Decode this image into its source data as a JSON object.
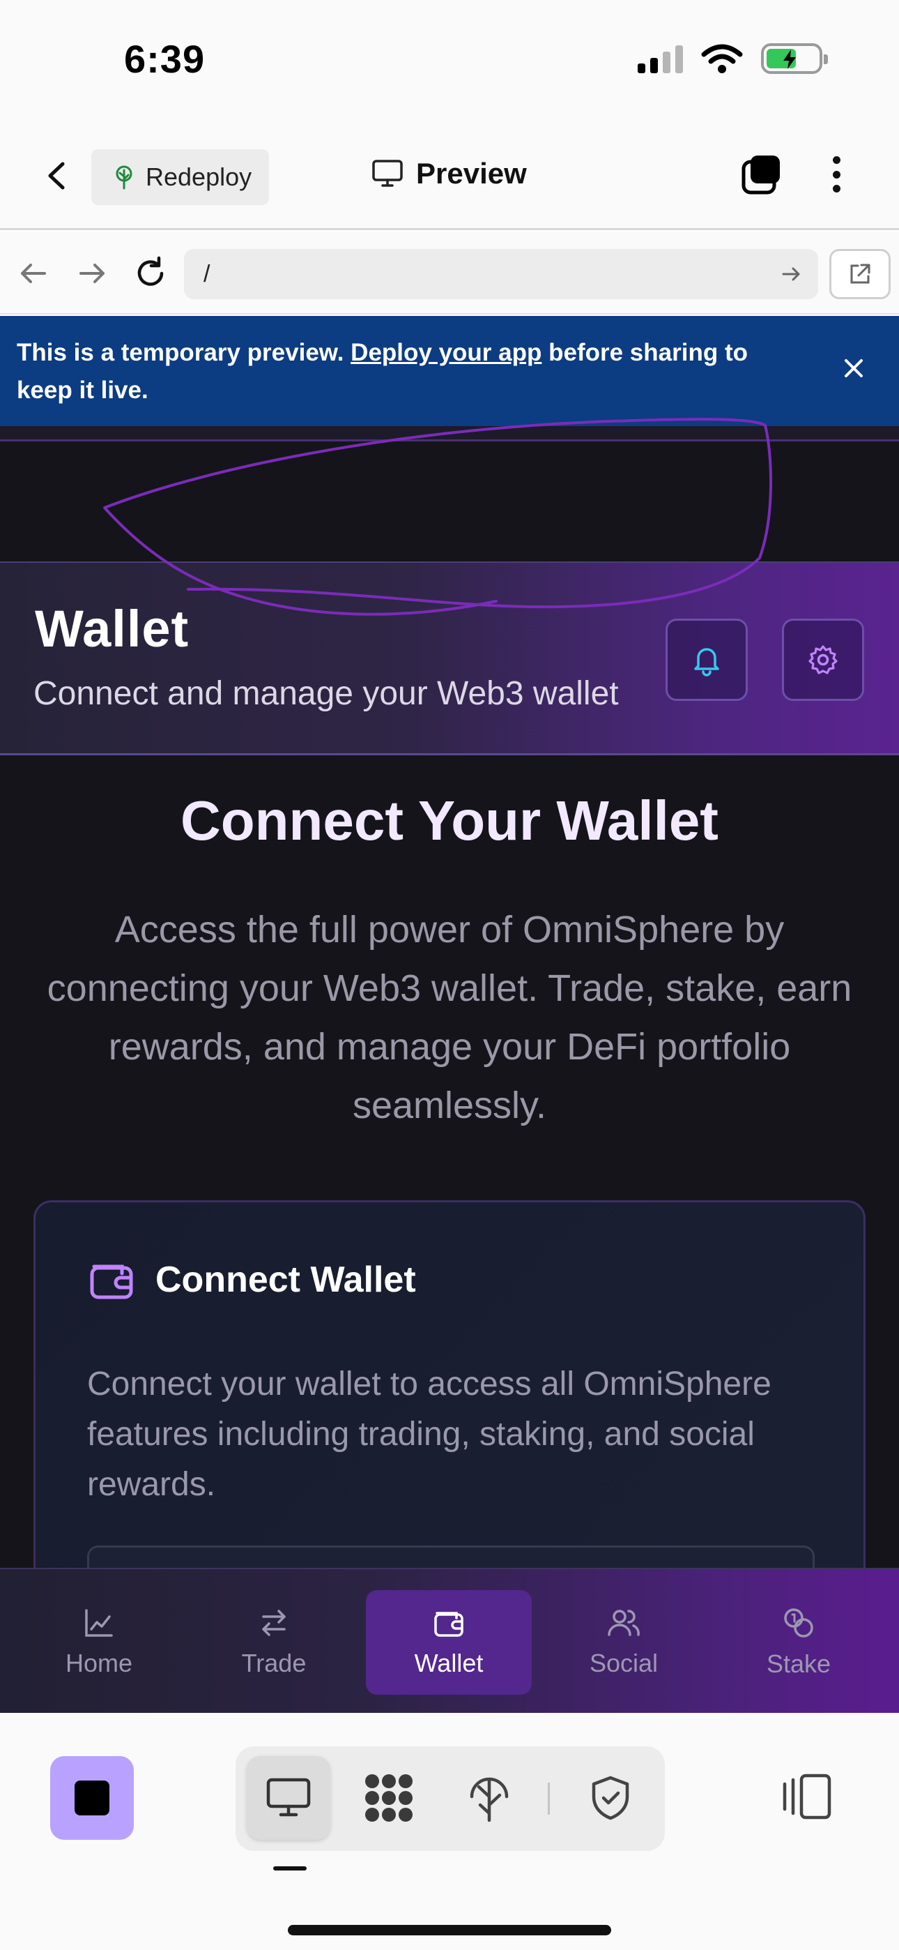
{
  "status_bar": {
    "time": "6:39",
    "battery_level": 0.58
  },
  "app_header": {
    "redeploy_label": "Redeploy",
    "preview_title": "Preview"
  },
  "browser": {
    "url": "/"
  },
  "banner": {
    "text_before": "This is a temporary preview. ",
    "link": "Deploy your app",
    "text_after": " before sharing to keep it live."
  },
  "wallet_header": {
    "title": "Wallet",
    "subtitle": "Connect and manage your Web3 wallet"
  },
  "main": {
    "title": "Connect Your Wallet",
    "description": "Access the full power of OmniSphere by connecting your Web3 wallet. Trade, stake, earn rewards, and manage your DeFi portfolio seamlessly."
  },
  "card": {
    "title": "Connect Wallet",
    "text": "Connect your wallet to access all OmniSphere features including trading, staking, and social rewards."
  },
  "tabs": [
    {
      "label": "Home",
      "icon": "chart-line-icon",
      "active": false
    },
    {
      "label": "Trade",
      "icon": "arrows-swap-icon",
      "active": false
    },
    {
      "label": "Wallet",
      "icon": "wallet-icon",
      "active": true
    },
    {
      "label": "Social",
      "icon": "users-icon",
      "active": false
    },
    {
      "label": "Stake",
      "icon": "coins-icon",
      "active": false
    }
  ],
  "colors": {
    "banner_bg": "#0c3c82",
    "app_bg": "#15141b",
    "accent_purple": "#53278e",
    "bell_icon": "#37c8f0",
    "gear_icon": "#c084fc",
    "stop_button": "#b9a2ff",
    "annotation_stroke": "#7a2cb8"
  }
}
